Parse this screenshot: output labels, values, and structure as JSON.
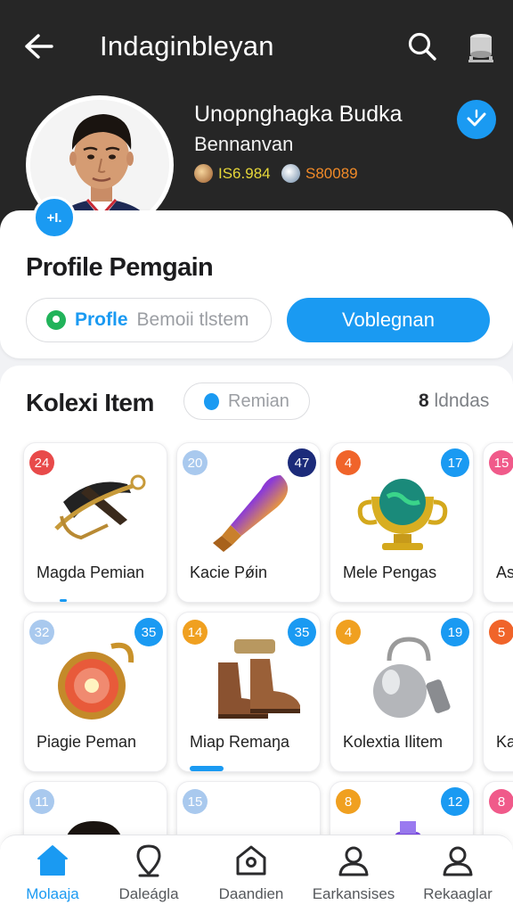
{
  "header": {
    "title": "Indaginbleyan",
    "back_icon": "arrow-left-icon",
    "search_icon": "search-icon",
    "device_icon": "drum-icon"
  },
  "profile": {
    "name": "Unopnghagka Budka",
    "subtitle": "Bennanvan",
    "stat1": "IS6.984",
    "stat2": "S80089",
    "avatar_edit_label": "+I.",
    "verify_icon": "verified-icon"
  },
  "profile_section": {
    "title": "Profile Pemgain",
    "pill_bold": "Profle",
    "pill_text": "Bemoii tlstem",
    "primary_button": "Voblegnan"
  },
  "collection": {
    "title": "Kolexi Item",
    "filter_chip": "Remian",
    "count_num": "8",
    "count_label": "ldndas",
    "items": [
      {
        "label": "Magda Pemian",
        "badge_left": "24",
        "badge_left_color": "#e84a4a",
        "badge_right": "",
        "badge_right_color": ""
      },
      {
        "label": "Kacie Pǿin",
        "badge_left": "20",
        "badge_left_color": "#a9c9ee",
        "badge_right": "47",
        "badge_right_color": "#1c2b7a"
      },
      {
        "label": "Mele Pengas",
        "badge_left": "4",
        "badge_left_color": "#f0642a",
        "badge_right": "17",
        "badge_right_color": "#1a9af2"
      },
      {
        "label": "As",
        "badge_left": "15",
        "badge_left_color": "#f05a8a",
        "badge_right": "",
        "badge_right_color": ""
      },
      {
        "label": "Piagie Peman",
        "badge_left": "32",
        "badge_left_color": "#a9c9ee",
        "badge_right": "35",
        "badge_right_color": "#1a9af2"
      },
      {
        "label": "Miap Remaŋa",
        "badge_left": "14",
        "badge_left_color": "#f0a020",
        "badge_right": "35",
        "badge_right_color": "#1a9af2"
      },
      {
        "label": "Kolextia Ilitem",
        "badge_left": "4",
        "badge_left_color": "#f0a020",
        "badge_right": "19",
        "badge_right_color": "#1a9af2"
      },
      {
        "label": "Ka",
        "badge_left": "5",
        "badge_left_color": "#f0642a",
        "badge_right": "",
        "badge_right_color": ""
      },
      {
        "label": "",
        "badge_left": "11",
        "badge_left_color": "#a9c9ee",
        "badge_right": "",
        "badge_right_color": ""
      },
      {
        "label": "",
        "badge_left": "15",
        "badge_left_color": "#a9c9ee",
        "badge_right": "",
        "badge_right_color": ""
      },
      {
        "label": "",
        "badge_left": "8",
        "badge_left_color": "#f0a020",
        "badge_right": "12",
        "badge_right_color": "#1a9af2"
      },
      {
        "label": "",
        "badge_left": "8",
        "badge_left_color": "#f05a8a",
        "badge_right": "",
        "badge_right_color": ""
      }
    ]
  },
  "bottom_nav": {
    "items": [
      {
        "label": "Molaaja",
        "icon": "home-icon",
        "active": true
      },
      {
        "label": "Daleágla",
        "icon": "map-pin-icon",
        "active": false
      },
      {
        "label": "Daandien",
        "icon": "house-icon",
        "active": false
      },
      {
        "label": "Earkansises",
        "icon": "user-icon",
        "active": false
      },
      {
        "label": "Rekaaglar",
        "icon": "user-icon",
        "active": false
      }
    ]
  },
  "colors": {
    "accent": "#1a9af2",
    "header_bg": "#262626",
    "stat1": "#e6d73a",
    "stat2": "#f08a28"
  }
}
